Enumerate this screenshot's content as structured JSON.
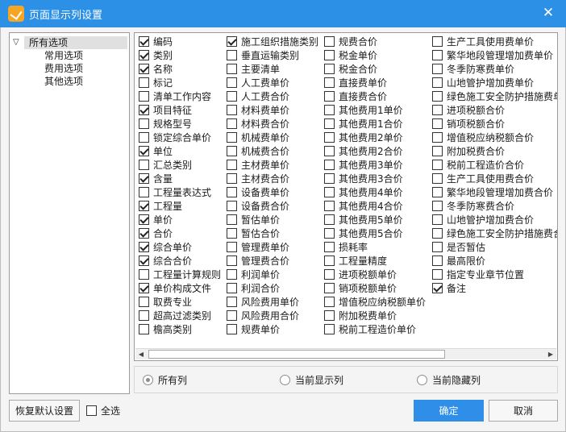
{
  "window": {
    "title": "页面显示列设置"
  },
  "tree": {
    "root": "所有选项",
    "children": [
      "常用选项",
      "费用选项",
      "其他选项"
    ]
  },
  "columns": [
    [
      {
        "label": "编码",
        "checked": true
      },
      {
        "label": "类别",
        "checked": true
      },
      {
        "label": "名称",
        "checked": true
      },
      {
        "label": "标记",
        "checked": false
      },
      {
        "label": "清单工作内容",
        "checked": false
      },
      {
        "label": "项目特征",
        "checked": true
      },
      {
        "label": "规格型号",
        "checked": false
      },
      {
        "label": "锁定综合单价",
        "checked": false
      },
      {
        "label": "单位",
        "checked": true
      },
      {
        "label": "汇总类别",
        "checked": false
      },
      {
        "label": "含量",
        "checked": true
      },
      {
        "label": "工程量表达式",
        "checked": false
      },
      {
        "label": "工程量",
        "checked": true
      },
      {
        "label": "单价",
        "checked": true
      },
      {
        "label": "合价",
        "checked": true
      },
      {
        "label": "综合单价",
        "checked": true
      },
      {
        "label": "综合合价",
        "checked": true
      },
      {
        "label": "工程量计算规则",
        "checked": false
      },
      {
        "label": "单价构成文件",
        "checked": true
      },
      {
        "label": "取费专业",
        "checked": false
      },
      {
        "label": "超高过滤类别",
        "checked": false
      },
      {
        "label": "檐高类别",
        "checked": false
      }
    ],
    [
      {
        "label": "施工组织措施类别",
        "checked": true
      },
      {
        "label": "垂直运输类别",
        "checked": false
      },
      {
        "label": "主要清单",
        "checked": false
      },
      {
        "label": "人工费单价",
        "checked": false
      },
      {
        "label": "人工费合价",
        "checked": false
      },
      {
        "label": "材料费单价",
        "checked": false
      },
      {
        "label": "材料费合价",
        "checked": false
      },
      {
        "label": "机械费单价",
        "checked": false
      },
      {
        "label": "机械费合价",
        "checked": false
      },
      {
        "label": "主材费单价",
        "checked": false
      },
      {
        "label": "主材费合价",
        "checked": false
      },
      {
        "label": "设备费单价",
        "checked": false
      },
      {
        "label": "设备费合价",
        "checked": false
      },
      {
        "label": "暂估单价",
        "checked": false
      },
      {
        "label": "暂估合价",
        "checked": false
      },
      {
        "label": "管理费单价",
        "checked": false
      },
      {
        "label": "管理费合价",
        "checked": false
      },
      {
        "label": "利润单价",
        "checked": false
      },
      {
        "label": "利润合价",
        "checked": false
      },
      {
        "label": "风险费用单价",
        "checked": false
      },
      {
        "label": "风险费用合价",
        "checked": false
      },
      {
        "label": "规费单价",
        "checked": false
      }
    ],
    [
      {
        "label": "规费合价",
        "checked": false
      },
      {
        "label": "税金单价",
        "checked": false
      },
      {
        "label": "税金合价",
        "checked": false
      },
      {
        "label": "直接费单价",
        "checked": false
      },
      {
        "label": "直接费合价",
        "checked": false
      },
      {
        "label": "其他费用1单价",
        "checked": false
      },
      {
        "label": "其他费用1合价",
        "checked": false
      },
      {
        "label": "其他费用2单价",
        "checked": false
      },
      {
        "label": "其他费用2合价",
        "checked": false
      },
      {
        "label": "其他费用3单价",
        "checked": false
      },
      {
        "label": "其他费用3合价",
        "checked": false
      },
      {
        "label": "其他费用4单价",
        "checked": false
      },
      {
        "label": "其他费用4合价",
        "checked": false
      },
      {
        "label": "其他费用5单价",
        "checked": false
      },
      {
        "label": "其他费用5合价",
        "checked": false
      },
      {
        "label": "损耗率",
        "checked": false
      },
      {
        "label": "工程量精度",
        "checked": false
      },
      {
        "label": "进项税额单价",
        "checked": false
      },
      {
        "label": "销项税额单价",
        "checked": false
      },
      {
        "label": "增值税应纳税额单价",
        "checked": false
      },
      {
        "label": "附加税费单价",
        "checked": false
      },
      {
        "label": "税前工程造价单价",
        "checked": false
      }
    ],
    [
      {
        "label": "生产工具使用费单价",
        "checked": false
      },
      {
        "label": "繁华地段管理增加费单价",
        "checked": false
      },
      {
        "label": "冬季防寒费单价",
        "checked": false
      },
      {
        "label": "山地管护增加费单价",
        "checked": false
      },
      {
        "label": "绿色施工安全防护措施费单",
        "checked": false
      },
      {
        "label": "进项税额合价",
        "checked": false
      },
      {
        "label": "销项税额合价",
        "checked": false
      },
      {
        "label": "增值税应纳税额合价",
        "checked": false
      },
      {
        "label": "附加税费合价",
        "checked": false
      },
      {
        "label": "税前工程造价合价",
        "checked": false
      },
      {
        "label": "生产工具使用费合价",
        "checked": false
      },
      {
        "label": "繁华地段管理增加费合价",
        "checked": false
      },
      {
        "label": "冬季防寒费合价",
        "checked": false
      },
      {
        "label": "山地管护增加费合价",
        "checked": false
      },
      {
        "label": "绿色施工安全防护措施费合",
        "checked": false
      },
      {
        "label": "是否暂估",
        "checked": false
      },
      {
        "label": "最高限价",
        "checked": false
      },
      {
        "label": "指定专业章节位置",
        "checked": false
      },
      {
        "label": "备注",
        "checked": true
      }
    ]
  ],
  "radios": [
    {
      "label": "所有列",
      "selected": true
    },
    {
      "label": "当前显示列",
      "selected": false
    },
    {
      "label": "当前隐藏列",
      "selected": false
    }
  ],
  "buttons": {
    "restore_default": "恢复默认设置",
    "select_all": "全选",
    "ok": "确定",
    "cancel": "取消"
  }
}
